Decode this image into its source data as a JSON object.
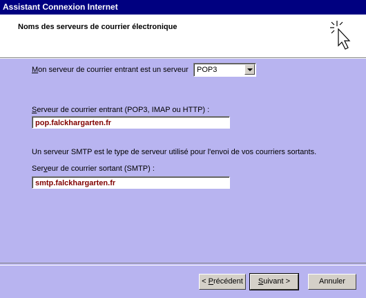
{
  "window": {
    "title": "Assistant Connexion Internet"
  },
  "header": {
    "title": "Noms des serveurs de courrier électronique"
  },
  "incoming_type": {
    "label_pre": "",
    "label_u": "M",
    "label_post": "on serveur de courrier entrant est un serveur",
    "selected": "POP3"
  },
  "incoming_server": {
    "label_pre": "",
    "label_u": "S",
    "label_post": "erveur de courrier entrant (POP3, IMAP ou HTTP) :",
    "value": "pop.falckhargarten.fr"
  },
  "smtp_info": "Un serveur SMTP est le type de serveur utilisé pour l'envoi de vos courriers sortants.",
  "outgoing_server": {
    "label_pre": "Ser",
    "label_u": "v",
    "label_post": "eur de courrier sortant (SMTP) :",
    "value": "smtp.falckhargarten.fr"
  },
  "buttons": {
    "back": {
      "pre": "< ",
      "u": "P",
      "post": "récédent"
    },
    "next": {
      "pre": "",
      "u": "S",
      "post": "uivant >"
    },
    "cancel": "Annuler"
  }
}
